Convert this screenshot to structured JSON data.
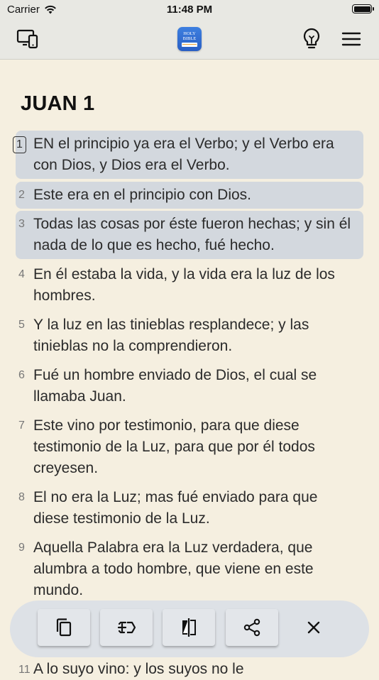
{
  "status_bar": {
    "carrier": "Carrier",
    "time": "11:48 PM"
  },
  "toolbar": {
    "left_icon": "devices-icon",
    "logo_text": "HOLY BIBLE",
    "right_icons": [
      "lightbulb-icon",
      "hamburger-menu-icon"
    ]
  },
  "chapter": {
    "title": "JUAN 1",
    "verses": [
      {
        "num": "1",
        "text": "EN el principio ya era el Verbo; y el Verbo era con Dios, y Dios era el Verbo."
      },
      {
        "num": "2",
        "text": "Este era en el principio con Dios."
      },
      {
        "num": "3",
        "text": "Todas las cosas por éste fueron hechas; y sin él nada de lo que es hecho, fué hecho."
      },
      {
        "num": "4",
        "text": "En él estaba la vida, y la vida era la luz de los hombres."
      },
      {
        "num": "5",
        "text": "Y la luz en las tinieblas resplandece; y las tinieblas no la comprendieron."
      },
      {
        "num": "6",
        "text": "Fué un hombre enviado de Dios, el cual se llamaba Juan."
      },
      {
        "num": "7",
        "text": "Este vino por testimonio, para que diese testimonio de la Luz, para que por él todos creyesen."
      },
      {
        "num": "8",
        "text": "El no era la Luz; mas fué enviado para que diese testimonio de la Luz."
      },
      {
        "num": "9",
        "text": "Aquella Palabra era la Luz verdadera, que alumbra a todo hombre, que viene en este mundo."
      },
      {
        "num": "11",
        "text": "A lo suyo vino: y los suyos no le"
      }
    ]
  },
  "action_bar": {
    "buttons": [
      "copy-icon",
      "add-note-icon",
      "compare-icon",
      "share-icon",
      "close-icon"
    ]
  },
  "colors": {
    "background": "#f5efe0",
    "selected": "#d3d8de",
    "bar": "#e8e8e3",
    "logo": "#2f6bd0"
  }
}
